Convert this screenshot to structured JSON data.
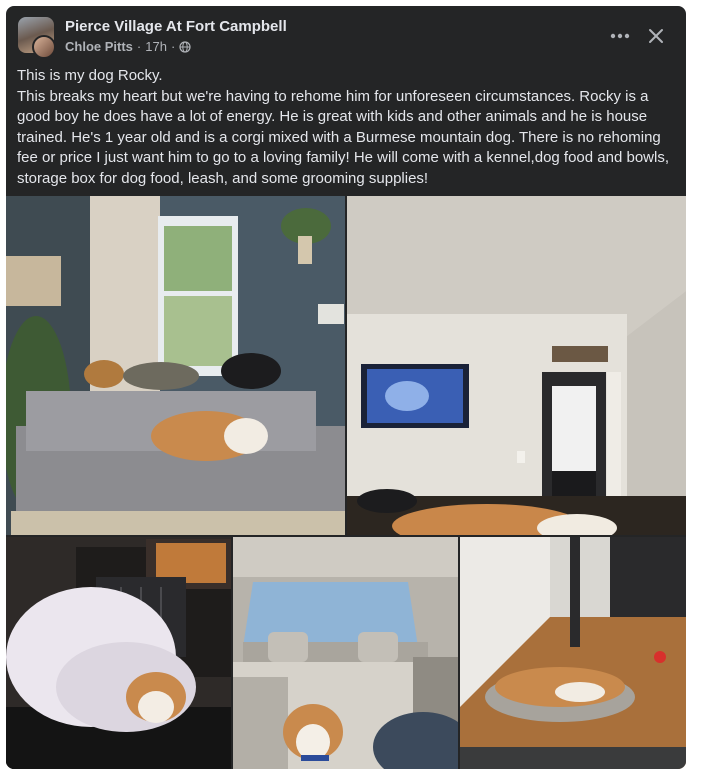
{
  "post": {
    "group_name": "Pierce Village At Fort Campbell",
    "author": "Chloe Pitts",
    "timestamp": "17h",
    "separator": "·",
    "audience_icon": "globe-icon",
    "text_line1": "This is my dog Rocky.",
    "text_body": "This breaks my heart but we're having to rehome him for unforeseen circumstances. Rocky is a good boy he does have a lot of energy. He is great with kids and other animals and he is house trained. He's 1 year old and is a corgi mixed with a Burmese mountain dog. There is no rehoming fee or price I just want him to go to a loving family! He will come with a kennel,dog food and bowls, storage box for dog food, leash, and some grooming supplies!"
  },
  "icons": {
    "more": "more-horizontal-icon",
    "close": "close-icon"
  },
  "photos": [
    {
      "name": "photo-dogs-on-couch"
    },
    {
      "name": "photo-living-room-tv"
    },
    {
      "name": "photo-dog-under-blanket"
    },
    {
      "name": "photo-dog-in-car"
    },
    {
      "name": "photo-dog-on-bed"
    }
  ],
  "colors": {
    "card_bg": "#242526",
    "text_primary": "#e4e6eb",
    "text_secondary": "#b0b3b8"
  }
}
